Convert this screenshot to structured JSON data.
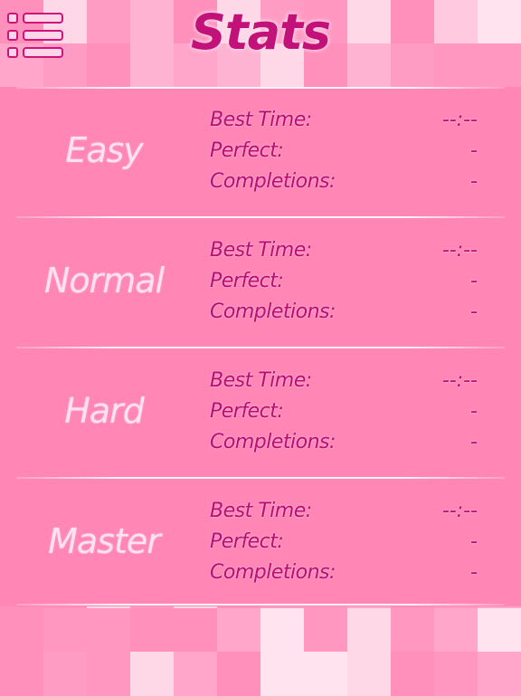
{
  "screen_title": "Stats",
  "menu_icon": "list-icon",
  "labels": {
    "best_time": "Best Time:",
    "perfect": "Perfect:",
    "completions": "Completions:"
  },
  "difficulties": [
    {
      "name": "Easy",
      "best_time": "--:--",
      "perfect": "-",
      "completions": "-"
    },
    {
      "name": "Normal",
      "best_time": "--:--",
      "perfect": "-",
      "completions": "-"
    },
    {
      "name": "Hard",
      "best_time": "--:--",
      "perfect": "-",
      "completions": "-"
    },
    {
      "name": "Master",
      "best_time": "--:--",
      "perfect": "-",
      "completions": "-"
    }
  ],
  "colors": {
    "background": "#ff8ab8",
    "accent": "#c3117a",
    "difficulty_text": "#ffe2ef"
  }
}
